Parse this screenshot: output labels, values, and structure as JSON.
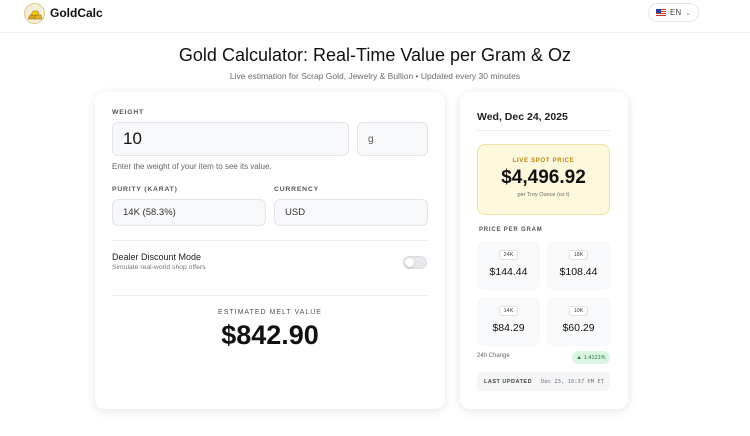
{
  "header": {
    "brand": "GoldCalc",
    "language": "EN"
  },
  "page": {
    "title": "Gold Calculator: Real-Time Value per Gram & Oz",
    "subtitle": "Live estimation for Scrap Gold, Jewelry & Bullion • Updated every 30 minutes"
  },
  "calculator": {
    "weight_label": "WEIGHT",
    "weight_value": "10",
    "unit_value": "g",
    "weight_hint": "Enter the weight of your item to see its value.",
    "purity_label": "PURITY (KARAT)",
    "purity_value": "14K (58.3%)",
    "currency_label": "CURRENCY",
    "currency_value": "USD",
    "dealer_title": "Dealer Discount Mode",
    "dealer_sub": "Simulate real-world shop offers",
    "dealer_enabled": false,
    "result_label": "ESTIMATED MELT VALUE",
    "result_value": "$842.90"
  },
  "sidebar": {
    "date": "Wed, Dec 24, 2025",
    "spot_label": "LIVE SPOT PRICE",
    "spot_value": "$4,496.92",
    "spot_unit": "per Troy Ounce (oz t)",
    "grid_label": "PRICE PER GRAM",
    "karats": [
      {
        "karat": "24K",
        "price": "$144.44"
      },
      {
        "karat": "18K",
        "price": "$108.44"
      },
      {
        "karat": "14K",
        "price": "$84.29"
      },
      {
        "karat": "10K",
        "price": "$60.29"
      }
    ],
    "change_label": "24h Change",
    "change_value": "1.4121%",
    "updated_label": "LAST UPDATED",
    "updated_value": "Dec 23, 10:37 PM ET"
  },
  "colors": {
    "spot_bg": "#fdf8dc",
    "spot_accent": "#b8860b",
    "change_bg": "#daf5e2",
    "change_text": "#1d7a3b"
  },
  "icons": [
    "gold-bars-logo-icon",
    "us-flag-icon",
    "chevron-down-icon",
    "up-triangle-icon"
  ]
}
